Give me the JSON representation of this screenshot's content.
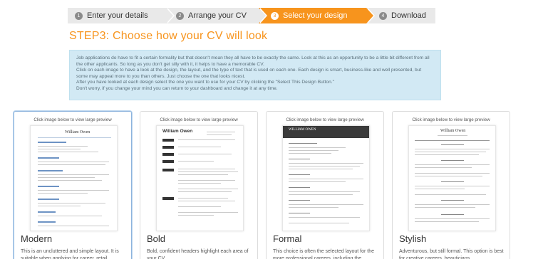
{
  "stepper": [
    {
      "num": "1",
      "label": "Enter your details"
    },
    {
      "num": "2",
      "label": "Arrange your CV"
    },
    {
      "num": "3",
      "label": "Select your design"
    },
    {
      "num": "4",
      "label": "Download"
    }
  ],
  "active_step_color": "#f7941d",
  "heading": "STEP3: Choose how your CV will look",
  "info": [
    "Job applications do have to fit a certain formality but that doesn't mean they all have to be exactly the same. Look at this as an opportunity to be a little bit different from all the other applicants. So long as you don't get silly with it, it helps to have a memorable CV.",
    "Click on each image to have a look at the design, the layout, and the type of text that is used on each one. Each design is smart, business-like and well presented, but some may appeal more to you than others. Just choose the one that looks nicest.",
    "After you have looked at each design select the one you want to use for your CV by clicking the \"Select This Design Button.\"",
    "Don't worry, if you change your mind you can return to your dashboard and change it at any time."
  ],
  "cards": [
    {
      "caption": "Click image below to view large preview",
      "cv_name": "William Owen",
      "name": "Modern",
      "desc": "This is an uncluttered and simple layout. It is suitable when applying for career, retail"
    },
    {
      "caption": "Click image below to view large preview",
      "cv_name": "William Owen",
      "name": "Bold",
      "desc": "Bold, confident headers highlight each area of your CV"
    },
    {
      "caption": "Click image below to view large preview",
      "cv_name": "WILLIAM OWEN",
      "name": "Formal",
      "desc": "This choice is often the selected layout for the more professional careers, including the"
    },
    {
      "caption": "Click image below to view large preview",
      "cv_name": "William Owen",
      "name": "Stylish",
      "desc": "Adventurous, but still formal. This option is best for creative careers, beauticians,"
    }
  ]
}
